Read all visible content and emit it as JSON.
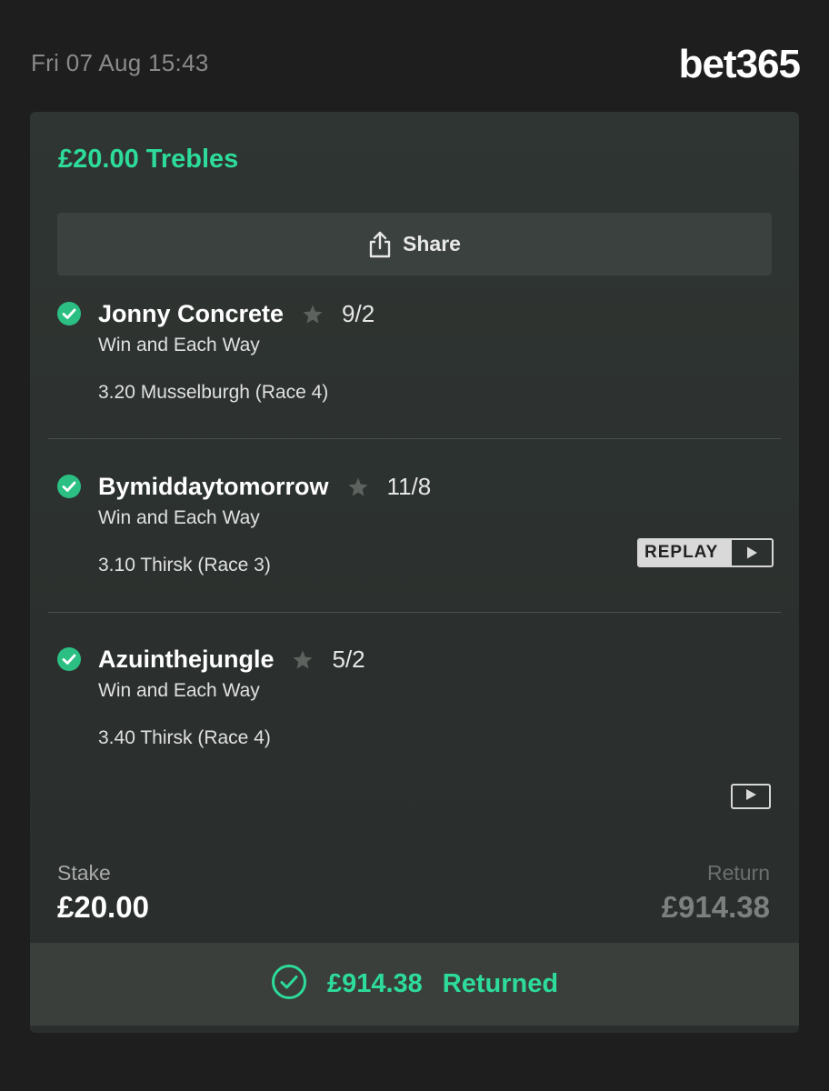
{
  "header": {
    "timestamp": "Fri 07 Aug 15:43",
    "brand": "bet365"
  },
  "bet": {
    "title": "£20.00 Trebles",
    "share_label": "Share",
    "selections": [
      {
        "name": "Jonny Concrete",
        "odds": "9/2",
        "market": "Win and Each Way",
        "event": "3.20 Musselburgh (Race 4)",
        "status": "won"
      },
      {
        "name": "Bymiddaytomorrow",
        "odds": "11/8",
        "market": "Win and Each Way",
        "event": "3.10 Thirsk (Race 3)",
        "status": "won",
        "replay_label": "REPLAY"
      },
      {
        "name": "Azuinthejungle",
        "odds": "5/2",
        "market": "Win and Each Way",
        "event": "3.40 Thirsk (Race 4)",
        "status": "won"
      }
    ],
    "stake_label": "Stake",
    "stake_value": "£20.00",
    "return_label": "Return",
    "return_value": "£914.38",
    "returned_amount": "£914.38",
    "returned_text": "Returned"
  },
  "colors": {
    "accent_green": "#2ddc9a",
    "background": "#1e1e1e",
    "card": "#2f3532"
  },
  "icons": {
    "share": "share-icon",
    "check": "check-circle-icon",
    "star": "star-icon",
    "play": "play-icon"
  }
}
